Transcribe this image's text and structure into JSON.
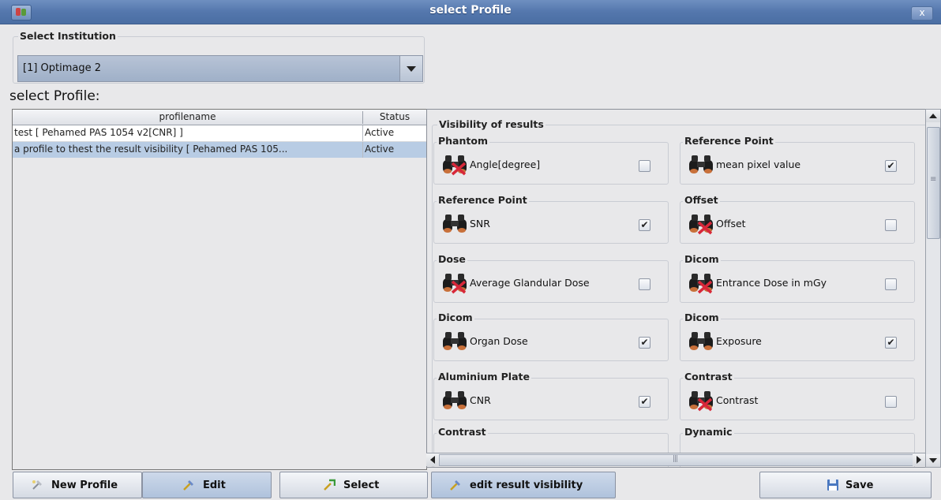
{
  "window": {
    "title": "select Profile",
    "close_label": "x"
  },
  "institution": {
    "group_title": "Select Institution",
    "selected": "[1] Optimage 2"
  },
  "profiles": {
    "heading": "select Profile:",
    "columns": [
      "profilename",
      "Status"
    ],
    "rows": [
      {
        "name": "test [ Pehamed PAS 1054 v2[CNR] ]",
        "status": "Active"
      },
      {
        "name": "a profile to thest the result visibility [ Pehamed PAS 105...",
        "status": "Active"
      }
    ]
  },
  "visibility": {
    "group_title": "Visibility of results",
    "items": [
      {
        "group": "Phantom",
        "label": "Angle[degree]",
        "checked": false,
        "icon": "binoculars-hidden-icon"
      },
      {
        "group": "Reference Point",
        "label": "mean pixel value",
        "checked": true,
        "icon": "binoculars-icon"
      },
      {
        "group": "Reference Point",
        "label": "SNR",
        "checked": true,
        "icon": "binoculars-icon"
      },
      {
        "group": "Offset",
        "label": "Offset",
        "checked": false,
        "icon": "binoculars-hidden-icon"
      },
      {
        "group": "Dose",
        "label": "Average Glandular Dose",
        "checked": false,
        "icon": "binoculars-hidden-icon"
      },
      {
        "group": "Dicom",
        "label": "Entrance Dose in mGy",
        "checked": false,
        "icon": "binoculars-hidden-icon"
      },
      {
        "group": "Dicom",
        "label": "Organ Dose",
        "checked": true,
        "icon": "binoculars-icon"
      },
      {
        "group": "Dicom",
        "label": "Exposure",
        "checked": true,
        "icon": "binoculars-icon"
      },
      {
        "group": "Aluminium Plate",
        "label": "CNR",
        "checked": true,
        "icon": "binoculars-icon"
      },
      {
        "group": "Contrast",
        "label": "Contrast",
        "checked": false,
        "icon": "binoculars-hidden-icon"
      },
      {
        "group": "Contrast",
        "label": "",
        "checked": false,
        "icon": ""
      },
      {
        "group": "Dynamic",
        "label": "",
        "checked": false,
        "icon": ""
      }
    ]
  },
  "buttons": {
    "new_profile": "New Profile",
    "edit": "Edit",
    "select": "Select",
    "edit_visibility": "edit result visibility",
    "save": "Save"
  },
  "colors": {
    "title_bar": "#5477ad",
    "selection": "#b8cce4",
    "panel_bg": "#e8e8ea"
  }
}
